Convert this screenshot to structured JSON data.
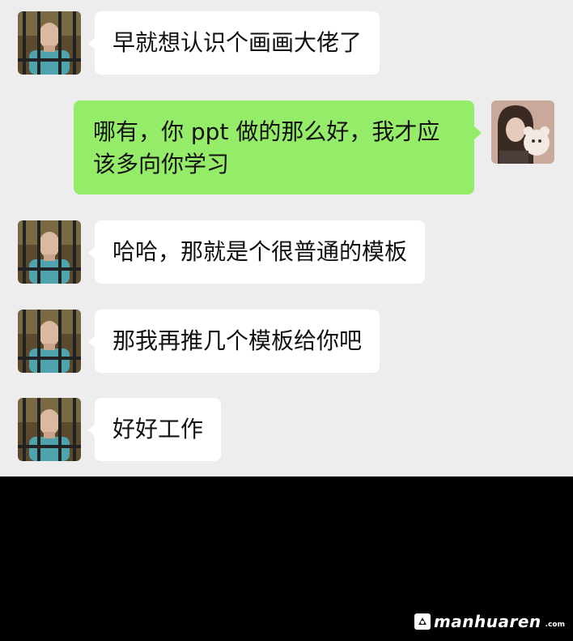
{
  "messages": [
    {
      "side": "left",
      "avatar": "prisoner-avatar",
      "text": "早就想认识个画画大佬了"
    },
    {
      "side": "right",
      "avatar": "girl-with-bear-avatar",
      "text": "哪有，你 ppt 做的那么好，我才应该多向你学习"
    },
    {
      "side": "left",
      "avatar": "prisoner-avatar",
      "text": "哈哈，那就是个很普通的模板"
    },
    {
      "side": "left",
      "avatar": "prisoner-avatar",
      "text": "那我再推几个模板给你吧"
    },
    {
      "side": "left",
      "avatar": "prisoner-avatar",
      "text": "好好工作"
    }
  ],
  "watermark": {
    "name": "manhuaren",
    "domain": ".com"
  },
  "colors": {
    "chat_bg": "#ededed",
    "incoming_bubble": "#ffffff",
    "outgoing_bubble": "#95ec69",
    "text": "#111111",
    "lower_bg": "#000000"
  }
}
